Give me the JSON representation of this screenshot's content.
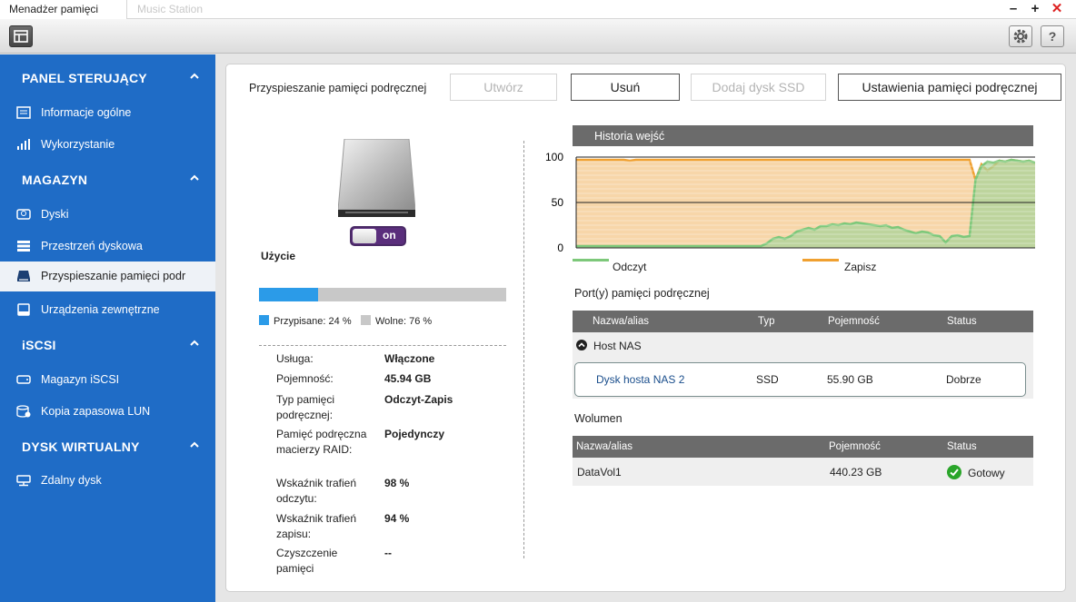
{
  "window": {
    "active_tab": "Menadżer pamięci",
    "inactive_tab": "Music Station",
    "controls": {
      "minimize": "–",
      "maximize": "+",
      "close": "✕"
    }
  },
  "sidebar": {
    "sections": [
      {
        "title": "PANEL STERUJĄCY",
        "items": [
          {
            "label": "Informacje ogólne",
            "icon": "monitor-icon"
          },
          {
            "label": "Wykorzystanie",
            "icon": "bar-chart-icon"
          }
        ]
      },
      {
        "title": "MAGAZYN",
        "items": [
          {
            "label": "Dyski",
            "icon": "disk-icon"
          },
          {
            "label": "Przestrzeń dyskowa",
            "icon": "storage-icon"
          },
          {
            "label": "Przyspieszanie pamięci podr",
            "icon": "ssd-icon",
            "selected": true
          },
          {
            "label": "Urządzenia zewnętrzne",
            "icon": "external-drive-icon"
          }
        ]
      },
      {
        "title": "iSCSI",
        "items": [
          {
            "label": "Magazyn iSCSI",
            "icon": "iscsi-icon"
          },
          {
            "label": "Kopia zapasowa LUN",
            "icon": "lun-backup-icon"
          }
        ]
      },
      {
        "title": "DYSK WIRTUALNY",
        "items": [
          {
            "label": "Zdalny dysk",
            "icon": "remote-disk-icon"
          }
        ]
      }
    ]
  },
  "main": {
    "title": "Przyspieszanie pamięci podręcznej",
    "buttons": {
      "create": "Utwórz",
      "remove": "Usuń",
      "add_ssd": "Dodaj dysk SSD",
      "settings": "Ustawienia pamięci podręcznej"
    },
    "toggle_label": "on",
    "usage": {
      "label": "Użycie",
      "used_fraction": 0.24,
      "used_legend": "Przypisane: 24 %",
      "free_legend": "Wolne: 76 %"
    },
    "info": [
      {
        "key": "Usługa:",
        "value": "Włączone"
      },
      {
        "key": "Pojemność:",
        "value": "45.94 GB"
      },
      {
        "key": "Typ pamięci podręcznej:",
        "value": "Odczyt-Zapis"
      },
      {
        "key": "Pamięć podręczna macierzy RAID:",
        "value": "Pojedynczy"
      },
      {
        "key": "Wskaźnik trafień odczytu:",
        "value": "98 %"
      },
      {
        "key": "Wskaźnik trafień zapisu:",
        "value": "94 %"
      },
      {
        "key": "Czyszczenie pamięci",
        "value": "--"
      }
    ]
  },
  "chart_data": {
    "type": "area",
    "title": "Historia wejść",
    "ylim": [
      0,
      100
    ],
    "yticks": [
      100,
      50,
      0
    ],
    "series": [
      {
        "name": "Odczyt",
        "color": "#7dc87a",
        "values": [
          2,
          2,
          2,
          2,
          2,
          2,
          2,
          2,
          2,
          2,
          2,
          2,
          2,
          2,
          2,
          2,
          2,
          2,
          2,
          2,
          2,
          2,
          2,
          2,
          2,
          2,
          2,
          2,
          2,
          2,
          2,
          2,
          5,
          10,
          12,
          10,
          13,
          18,
          20,
          22,
          20,
          24,
          24,
          26,
          25,
          27,
          26,
          28,
          27,
          26,
          25,
          24,
          25,
          22,
          23,
          20,
          18,
          16,
          18,
          17,
          14,
          13,
          6,
          13,
          14,
          12,
          13,
          75,
          90,
          95,
          94,
          96,
          95,
          97,
          96,
          95,
          96,
          94
        ]
      },
      {
        "name": "Zapisz",
        "color": "#f0a030",
        "values": [
          97,
          97,
          97,
          97,
          97,
          97,
          97,
          97,
          97,
          96,
          97,
          97,
          97,
          97,
          97,
          97,
          97,
          97,
          97,
          97,
          97,
          97,
          97,
          97,
          97,
          97,
          97,
          97,
          97,
          97,
          97,
          97,
          97,
          97,
          97,
          97,
          97,
          97,
          97,
          97,
          97,
          97,
          97,
          97,
          97,
          97,
          97,
          97,
          97,
          97,
          97,
          97,
          97,
          97,
          97,
          97,
          97,
          97,
          97,
          97,
          97,
          97,
          97,
          97,
          97,
          97,
          97,
          75,
          92,
          85,
          90,
          96,
          95,
          97,
          96,
          95,
          96,
          94
        ]
      }
    ]
  },
  "cache_ports": {
    "title": "Port(y) pamięci podręcznej",
    "columns": [
      "Nazwa/alias",
      "Typ",
      "Pojemność",
      "Status"
    ],
    "group": "Host NAS",
    "rows": [
      {
        "name": "Dysk hosta NAS 2",
        "type": "SSD",
        "capacity": "55.90 GB",
        "status": "Dobrze"
      }
    ]
  },
  "volumes": {
    "title": "Wolumen",
    "columns": [
      "Nazwa/alias",
      "Pojemność",
      "Status"
    ],
    "rows": [
      {
        "name": "DataVol1",
        "capacity": "440.23 GB",
        "status": "Gotowy"
      }
    ]
  },
  "colors": {
    "sidebar": "#1f6cc6",
    "accent": "#2b9be8",
    "ok": "#2aa52a"
  }
}
